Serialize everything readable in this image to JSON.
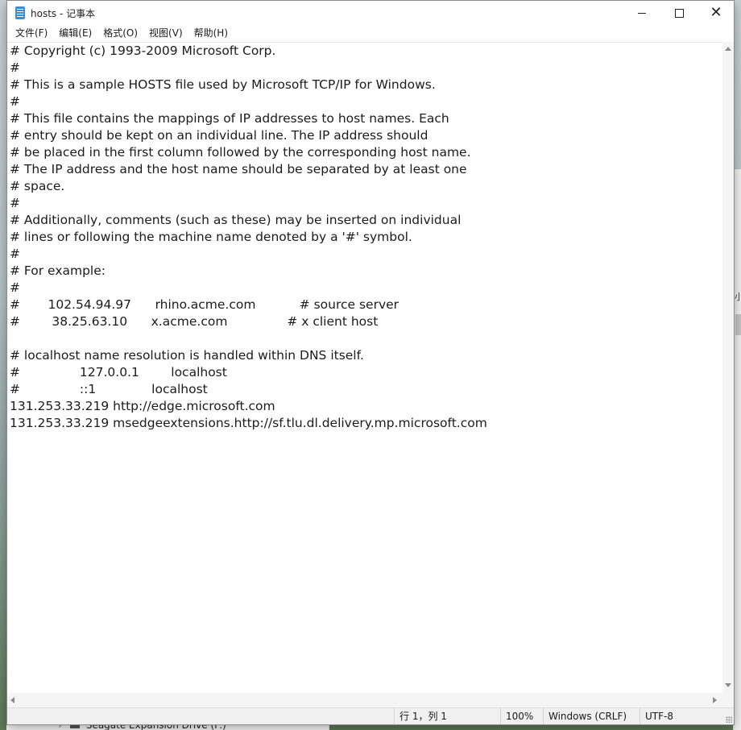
{
  "window": {
    "title": "hosts - 记事本",
    "minimize_icon": "minimize-icon",
    "maximize_icon": "maximize-icon",
    "close_icon": "close-icon",
    "close_glyph": "✕"
  },
  "menu": {
    "items": [
      {
        "label": "文件(F)"
      },
      {
        "label": "编辑(E)"
      },
      {
        "label": "格式(O)"
      },
      {
        "label": "视图(V)"
      },
      {
        "label": "帮助(H)"
      }
    ]
  },
  "editor": {
    "lines": [
      "# Copyright (c) 1993-2009 Microsoft Corp.",
      "#",
      "# This is a sample HOSTS file used by Microsoft TCP/IP for Windows.",
      "#",
      "# This file contains the mappings of IP addresses to host names. Each",
      "# entry should be kept on an individual line. The IP address should",
      "# be placed in the first column followed by the corresponding host name.",
      "# The IP address and the host name should be separated by at least one",
      "# space.",
      "#",
      "# Additionally, comments (such as these) may be inserted on individual",
      "# lines or following the machine name denoted by a '#' symbol.",
      "#",
      "# For example:",
      "#",
      "#       102.54.94.97      rhino.acme.com           # source server",
      "#        38.25.63.10      x.acme.com               # x client host",
      "",
      "# localhost name resolution is handled within DNS itself.",
      "#               127.0.0.1        localhost",
      "#               ::1              localhost",
      "131.253.33.219 http://edge.microsoft.com",
      "131.253.33.219 msedgeextensions.http://sf.tlu.dl.delivery.mp.microsoft.com"
    ]
  },
  "status": {
    "position": "行 1，列 1",
    "zoom": "100%",
    "line_ending": "Windows (CRLF)",
    "encoding": "UTF-8"
  },
  "background": {
    "explorer_item": "Seagate Expansion Drive (F:)",
    "explorer_chevron": "›",
    "right_mark": "小"
  }
}
